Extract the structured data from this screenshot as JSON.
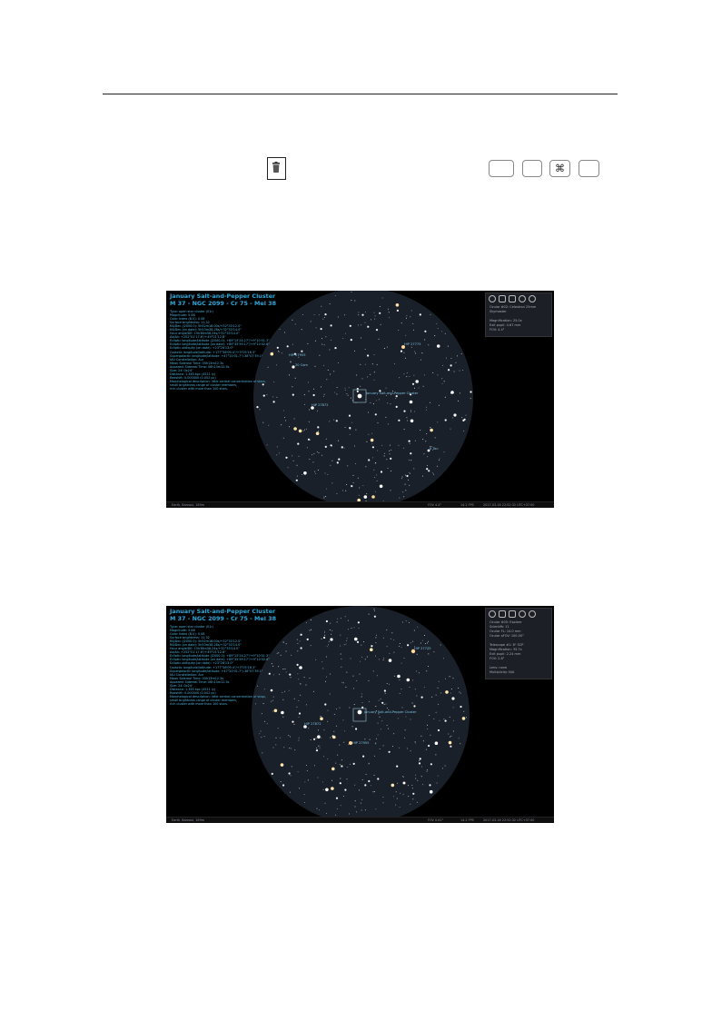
{
  "keys": {
    "k1": "",
    "k2": "",
    "k3": "⌘",
    "k4": ""
  },
  "fig1": {
    "title": "January Salt-and-Pepper Cluster",
    "subtitle": "M 37 - NGC 2099 - Cr 75 - Mel 38",
    "lines": [
      "Type: open star cluster (II1r)",
      "Magnitude: 5.68",
      "Color Index (B-V): 0.08",
      "Surface brightness: 11.32",
      "RA/Dec (J2000.0): 5h52m18.00s/+32°33'12.0\"",
      "RA/Dec (on date): 5h53m38.28s/+32°33'14.0\"",
      "Hour angle/DE: 15h38m56.24s/+32°33'14.0\"",
      "Az/Alt: +252°01'17.6\"/+49°01'12.8\"",
      "Ecliptic longitude/latitude (J2000.0): +89°15'24.27\"/+9°10'01.3\"",
      "Ecliptic longitude/latitude (on date): +89°35'59.17\"/+9°10'02.8\"",
      "Ecliptic obliquity (on date): +23°26'13.0\"",
      "Galactic longitude/latitude: +177°38'09.4\"/+3°05'16.3\"",
      "Supergalactic longitude/latitude: +47°20'01.7\"/-38°07'39.1\"",
      "IAU Constellation: Aur",
      "Mean Sidereal Time: 05h13m12.3s",
      "Apparent Sidereal Time: 06h13m12.5s",
      "Size: 24'.0x24'",
      "Distance: 1.383 kpc (4511 ly)",
      "Redshift: 0.000000 (0.002 pc)",
      "Morphological description: little central concentration of stars,",
      "small brightness range of cluster members,",
      "rich cluster with more than 100 stars."
    ],
    "panel_lines": [
      "Ocular #02: Celestron 25mm",
      "Skymaster",
      "",
      "Magnification: 25.0x",
      "Exit pupil: 4.67 mm",
      "FOV: 4.4°"
    ],
    "labels": {
      "center": "January Salt-and-Pepper Cluster",
      "a": "HIP 27775",
      "b": "HIP 27872",
      "c": "HIP 27955",
      "d": "20 Cam",
      "e": "8 Tau"
    },
    "status": {
      "location": "Earth, Bamaul, 169m",
      "fov": "FOV 4.4°",
      "fps": "14.2 FPS",
      "datetime": "2017-03-16 22:52:32 UTC+07:00"
    }
  },
  "fig2": {
    "title": "January Salt-and-Pepper Cluster",
    "subtitle": "M 37 - NGC 2099 - Cr 75 - Mel 38",
    "lines": [
      "Type: open star cluster (II1r)",
      "Magnitude: 5.68",
      "Color Index (B-V): 0.08",
      "Surface brightness: 11.32",
      "RA/Dec (J2000.0): 5h52m18.00s/+32°33'12.0\"",
      "RA/Dec (on date): 5h53m38.28s/+32°33'14.0\"",
      "Hour angle/DE: 15h38m56.24s/+32°33'14.0\"",
      "Az/Alt: +252°01'17.6\"/+49°01'12.8\"",
      "Ecliptic longitude/latitude (J2000.0): +89°15'24.27\"/+9°10'01.3\"",
      "Ecliptic longitude/latitude (on date): +89°35'59.17\"/+9°10'02.8\"",
      "Ecliptic obliquity (on date): +23°26'13.0\"",
      "Galactic longitude/latitude: +177°38'09.4\"/+3°05'16.3\"",
      "Supergalactic longitude/latitude: +47°20'01.7\"/-38°07'39.1\"",
      "IAU Constellation: Aur",
      "Mean Sidereal Time: 05h13m12.3s",
      "Apparent Sidereal Time: 06h13m12.5s",
      "Size: 24'.0x24'",
      "Distance: 1.383 kpc (4511 ly)",
      "Redshift: 0.000000 (0.002 pc)",
      "Morphological description: little central concentration of stars,",
      "small brightness range of cluster members,",
      "rich cluster with more than 100 stars."
    ],
    "panel_lines": [
      "Ocular #05: Explore",
      "Scientific 11",
      "Ocular FL: 14.0 mm",
      "Ocular aFOV: 100.00°",
      "",
      "Telescope #1: 8\" SCP",
      "Magnification: 35.7x",
      "Exit pupil: 2.24 mm",
      "FOV: 2.8°",
      "",
      "Lens: none",
      "Multiplicity: N/A"
    ],
    "labels": {
      "center": "January Salt-and-Pepper Cluster",
      "a": "HIP 27775",
      "b": "HIP 27872",
      "c": "HIP 27955"
    },
    "status": {
      "location": "Earth, Bamaul, 169m",
      "fov": "FOV 0.61°",
      "fps": "14.2 FPS",
      "datetime": "2017-03-16 22:52:32 UTC+07:00"
    }
  }
}
